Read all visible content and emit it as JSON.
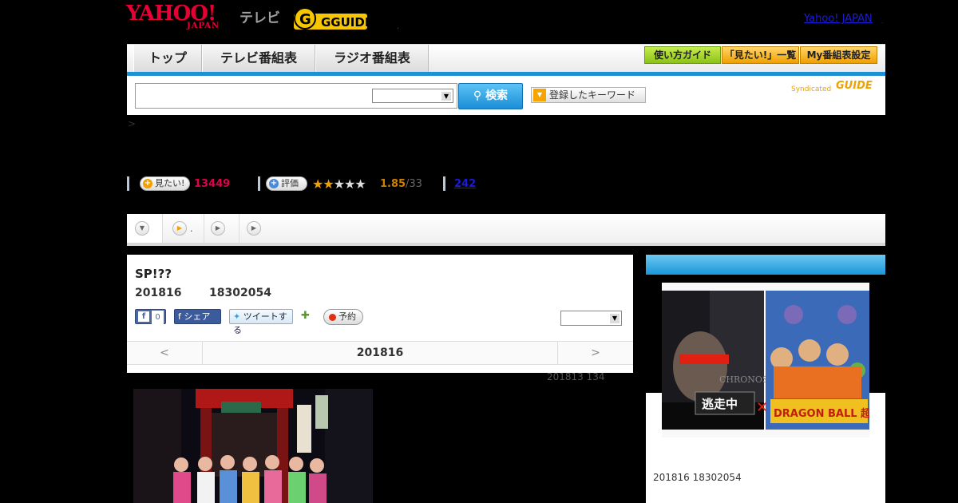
{
  "header": {
    "yahoo_logo": "YAHOO!",
    "yahoo_logo_sub": "JAPAN",
    "service_label": "テレビ",
    "gguide_logo": "GGUIDE",
    "dot": ".",
    "yahoo_link": "Yahoo! JAPAN",
    "yahoo_link_dot": "."
  },
  "nav": {
    "tabs": [
      {
        "label": "トップ"
      },
      {
        "label": "テレビ番組表"
      },
      {
        "label": "ラジオ番組表"
      }
    ],
    "buttons": [
      {
        "label": "使い方ガイド"
      },
      {
        "label": "「見たい!」一覧"
      },
      {
        "label": "My番組表設定"
      }
    ]
  },
  "search": {
    "query": "",
    "select_value": "",
    "button_label": "検索",
    "keyword_button_label": "登録したキーワード",
    "syndicated_label": "Syndicated",
    "syndicated_logo": "GUIDE"
  },
  "breadcrumb": ">",
  "stats": {
    "want_label": "見たい!",
    "want_count": "13449",
    "rate_label": "評価",
    "rating": 1.85,
    "rating_text": "1.85",
    "rating_of": "/33",
    "comments": "242"
  },
  "tabs_bar": {
    "item2_label": "."
  },
  "program": {
    "title": "SP!??",
    "date": "201816",
    "time": "18302054",
    "fb_like_label": "f",
    "fb_like_count": "0",
    "fb_share_label": "f シェア",
    "tweet_label": "ツイートする",
    "reserve_label": "予約",
    "select_value": "",
    "nav_prev": "<",
    "nav_date": "201816",
    "nav_next": ">",
    "update_note": "201813  134"
  },
  "side": {
    "image_text_left": "逃走中",
    "image_text_cross": "✕",
    "image_text_right": "DRAGON BALL 超",
    "image_label_chronos": "CHRONOS",
    "date_time": "201816  18302054"
  },
  "colors": {
    "accent_blue": "#1e90d6",
    "want_red": "#e0004d",
    "rating_orange": "#d08000"
  }
}
